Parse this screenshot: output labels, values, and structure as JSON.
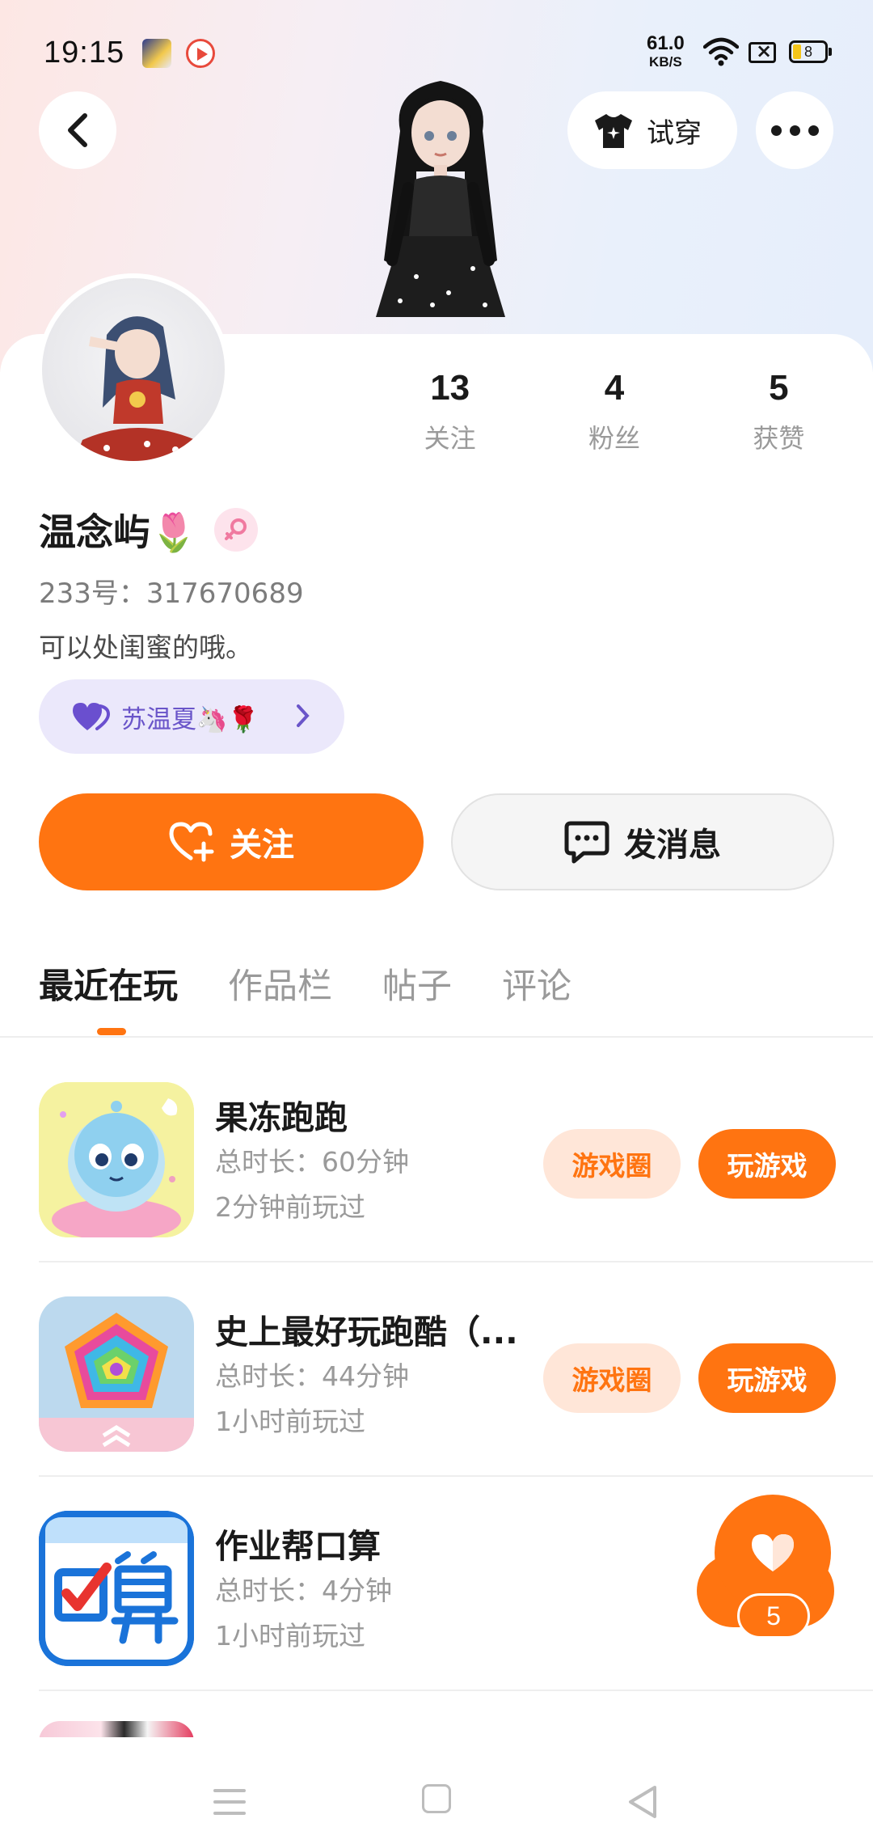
{
  "status_bar": {
    "time": "19:15",
    "net_speed_value": "61.0",
    "net_speed_unit": "KB/S",
    "battery": "8"
  },
  "header": {
    "try_on_label": "试穿"
  },
  "profile": {
    "stats": [
      {
        "value": "13",
        "label": "关注"
      },
      {
        "value": "4",
        "label": "粉丝"
      },
      {
        "value": "5",
        "label": "获赞"
      }
    ],
    "name": "温念屿🌷",
    "uid": "233号：317670689",
    "bio": "可以处闺蜜的哦。",
    "bestie_label": "苏温夏🦄🌹"
  },
  "actions": {
    "follow_label": "关注",
    "message_label": "发消息"
  },
  "tabs": [
    {
      "label": "最近在玩",
      "active": true
    },
    {
      "label": "作品栏",
      "active": false
    },
    {
      "label": "帖子",
      "active": false
    },
    {
      "label": "评论",
      "active": false
    }
  ],
  "games": [
    {
      "title": "果冻跑跑",
      "duration": "总时长：60分钟",
      "last_played": "2分钟前玩过",
      "circle_label": "游戏圈",
      "play_label": "玩游戏"
    },
    {
      "title": "史上最好玩跑酷（...",
      "duration": "总时长：44分钟",
      "last_played": "1小时前玩过",
      "circle_label": "游戏圈",
      "play_label": "玩游戏"
    },
    {
      "title": "作业帮口算",
      "duration": "总时长：4分钟",
      "last_played": "1小时前玩过"
    }
  ],
  "like_fab": {
    "count": "5"
  },
  "colors": {
    "accent": "#ff7411",
    "accent_light": "#ffe6d8",
    "bestie_bg": "#ebe8fb",
    "bestie_text": "#6a55c9"
  },
  "icons": [
    "back-arrow-icon",
    "shirt-icon",
    "more-dots-icon",
    "female-icon",
    "heart-icon",
    "chevron-right-icon",
    "heart-plus-icon",
    "chat-bubble-icon",
    "menu-icon",
    "home-square-icon",
    "back-triangle-icon"
  ]
}
